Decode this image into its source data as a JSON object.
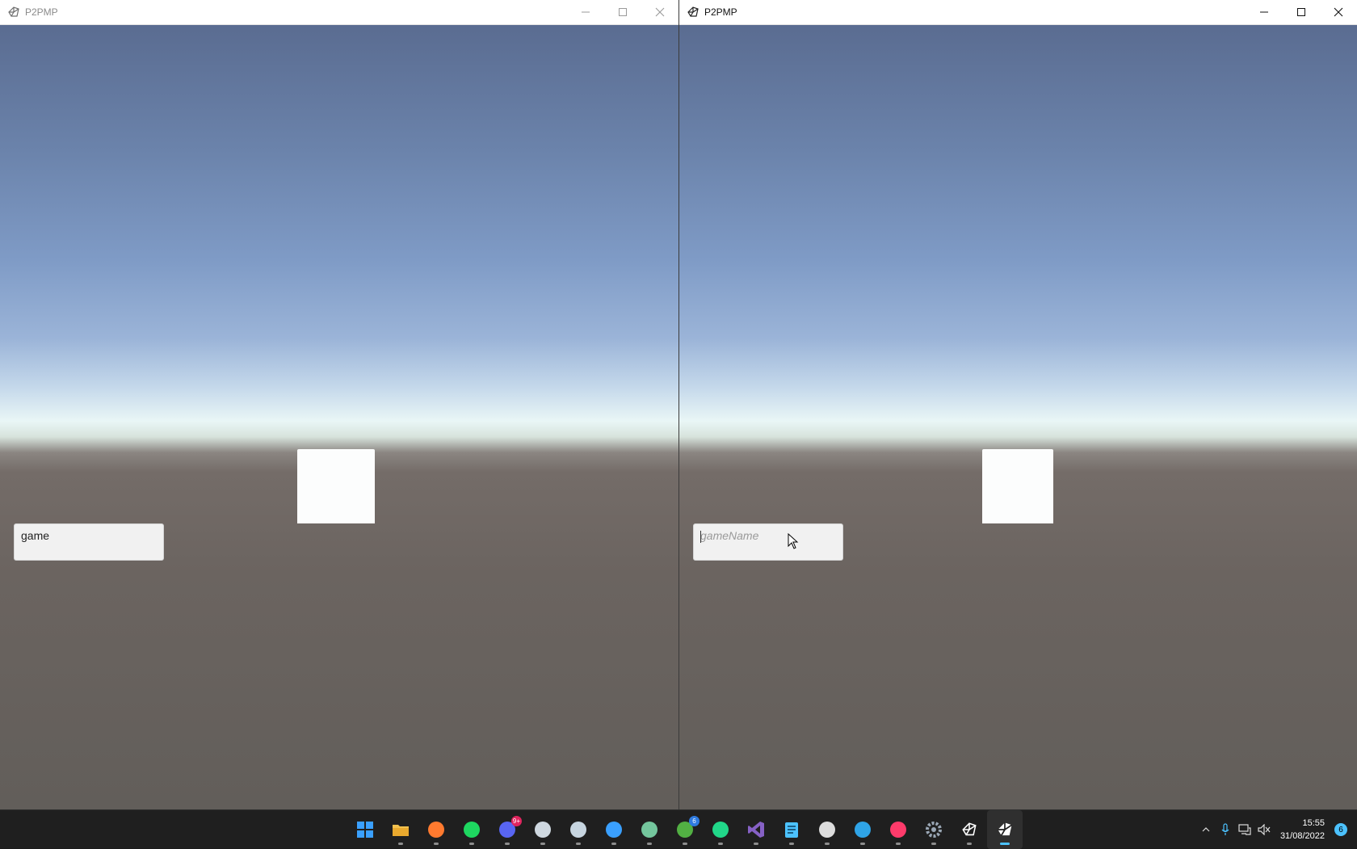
{
  "windows": {
    "left": {
      "title": "P2PMP",
      "input_value": "game"
    },
    "right": {
      "title": "P2PMP",
      "input_placeholder": "gameName"
    }
  },
  "taskbar": {
    "apps": [
      {
        "name": "start-icon",
        "color": "#3aa0ff"
      },
      {
        "name": "file-explorer-icon",
        "color": "#f2c14e"
      },
      {
        "name": "firefox-icon",
        "color": "#ff7a2f"
      },
      {
        "name": "spotify-icon",
        "color": "#1ed760"
      },
      {
        "name": "discord-icon",
        "color": "#5865f2",
        "badge": "9+"
      },
      {
        "name": "image-viewer-icon",
        "color": "#cfd8e0"
      },
      {
        "name": "steam-icon",
        "color": "#c7d5e0"
      },
      {
        "name": "photos-icon",
        "color": "#3aa0ff"
      },
      {
        "name": "chatgpt-icon",
        "color": "#74c69d"
      },
      {
        "name": "xbox-icon",
        "color": "#52b043",
        "badge": "6"
      },
      {
        "name": "pycharm-icon",
        "color": "#21d789"
      },
      {
        "name": "visual-studio-icon",
        "color": "#8661c5"
      },
      {
        "name": "notepad-icon",
        "color": "#4cc2ff"
      },
      {
        "name": "obs-icon",
        "color": "#dddddd"
      },
      {
        "name": "edge-icon",
        "color": "#2fa4e7"
      },
      {
        "name": "draw-app-icon",
        "color": "#ff3b6b"
      },
      {
        "name": "settings-icon",
        "color": "#9aa7b5"
      },
      {
        "name": "unity-editor-icon",
        "color": "#ffffff"
      },
      {
        "name": "unity-player-icon",
        "color": "#ffffff"
      }
    ],
    "clock": {
      "time": "15:55",
      "date": "31/08/2022"
    },
    "notification_count": "6"
  }
}
